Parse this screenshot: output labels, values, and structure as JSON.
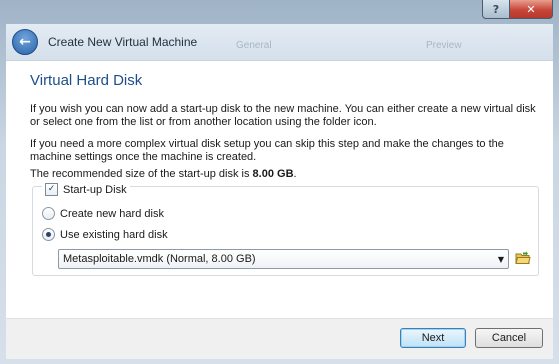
{
  "window": {
    "title": "Create New Virtual Machine",
    "help_label": "?",
    "close_label": "✕",
    "background_labels": [
      "General",
      "Preview"
    ]
  },
  "page": {
    "heading": "Virtual Hard Disk",
    "para1": "If you wish you can now add a start-up disk to the new machine. You can either create a new virtual disk or select one from the list or from another location using the folder icon.",
    "para2": "If you need a more complex virtual disk setup you can skip this step and make the changes to the machine settings once the machine is created.",
    "recommended_prefix": "The recommended size of the start-up disk is ",
    "recommended_size": "8.00 GB",
    "recommended_suffix": "."
  },
  "startup_disk": {
    "label": "Start-up Disk",
    "checked": true,
    "options": [
      {
        "label": "Create new hard disk",
        "selected": false
      },
      {
        "label": "Use existing hard disk",
        "selected": true
      }
    ],
    "existing_disk": "Metasploitable.vmdk (Normal, 8.00 GB)",
    "folder_icon": "folder-open-icon"
  },
  "buttons": {
    "next": "Next",
    "cancel": "Cancel"
  },
  "colors": {
    "heading": "#1e4e8c",
    "accent": "#3c7fb1"
  }
}
